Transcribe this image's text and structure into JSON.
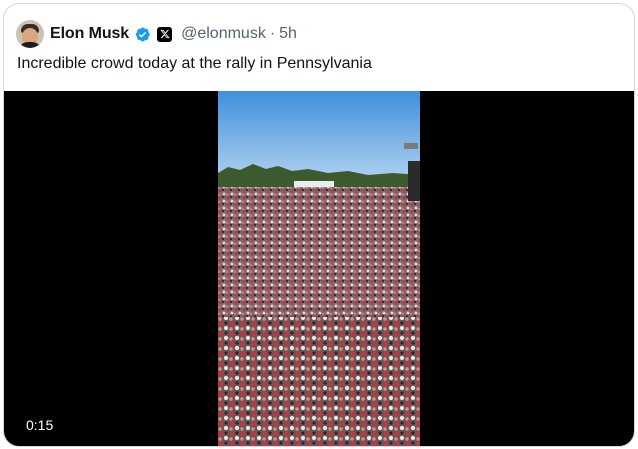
{
  "tweet": {
    "author_name": "Elon Musk",
    "handle": "@elonmusk",
    "separator": "·",
    "time": "5h",
    "text": "Incredible crowd today at the rally in Pennsylvania",
    "video": {
      "duration": "0:15"
    }
  },
  "icons": {
    "verified": "verified-badge-icon",
    "affiliate": "x-logo-icon"
  },
  "colors": {
    "verified_blue": "#1d9bf0",
    "name_text": "#0f1419",
    "secondary_text": "#536471",
    "border": "#cfd9de",
    "media_background": "#000000"
  }
}
